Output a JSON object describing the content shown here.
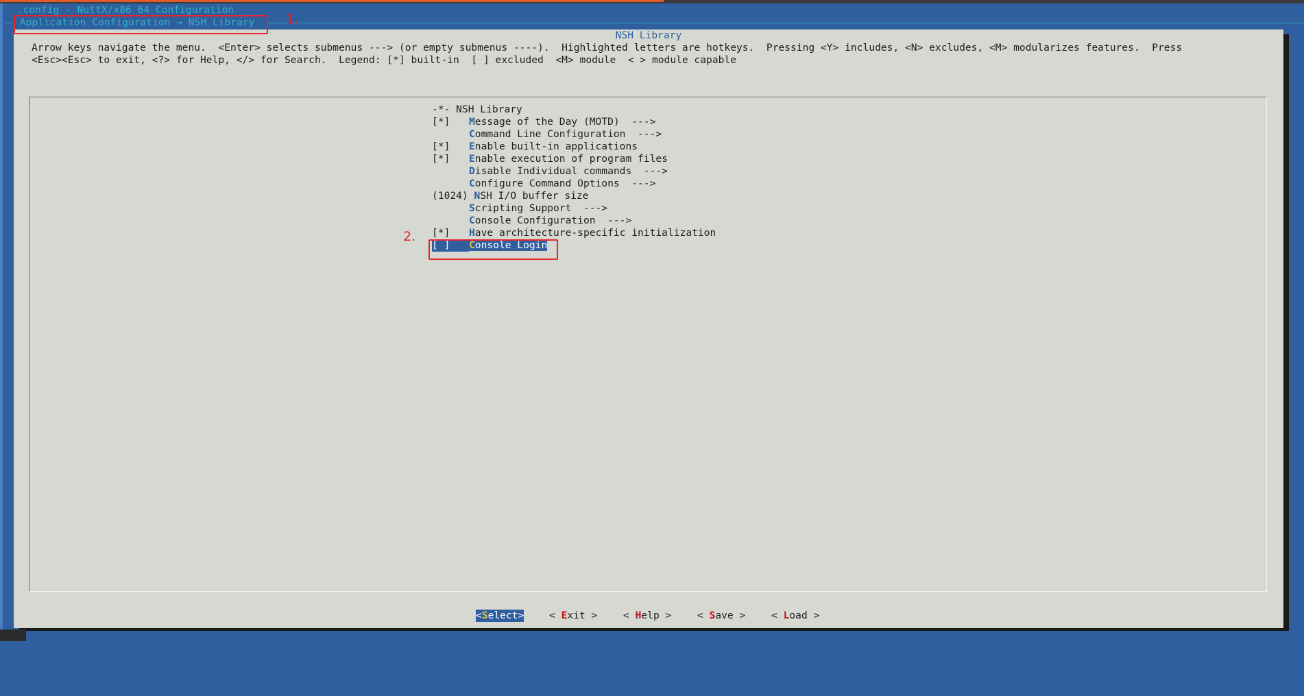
{
  "window": {
    "title": " .config - NuttX/x86_64 Configuration",
    "breadcrumb": " Application Configuration → NSH Library "
  },
  "annotations": [
    {
      "label": "1."
    },
    {
      "label": "2."
    }
  ],
  "dialog": {
    "title": "NSH Library",
    "help_line1": "Arrow keys navigate the menu.  <Enter> selects submenus ---> (or empty submenus ----).  Highlighted letters are hotkeys.  Pressing <Y> includes, <N> excludes, <M> modularizes features.  Press",
    "help_line2": "<Esc><Esc> to exit, <?> for Help, </> for Search.  Legend: [*] built-in  [ ] excluded  <M> module  < > module capable"
  },
  "menu": {
    "items": [
      {
        "prefix": "-*- ",
        "hotkey": "",
        "rest": "NSH Library",
        "prefix_full": true
      },
      {
        "prefix": "[*]",
        "hotkey": "M",
        "rest": "essage of the Day (MOTD)  --->"
      },
      {
        "prefix": "",
        "hotkey": "C",
        "rest": "ommand Line Configuration  --->"
      },
      {
        "prefix": "[*]",
        "hotkey": "E",
        "rest": "nable built-in applications"
      },
      {
        "prefix": "[*]",
        "hotkey": "E",
        "rest": "nable execution of program files"
      },
      {
        "prefix": "",
        "hotkey": "D",
        "rest": "isable Individual commands  --->"
      },
      {
        "prefix": "",
        "hotkey": "C",
        "rest": "onfigure Command Options  --->"
      },
      {
        "prefix": "(1024) ",
        "hotkey": "N",
        "rest": "SH I/O buffer size",
        "prefix_full": true
      },
      {
        "prefix": "",
        "hotkey": "S",
        "rest": "cripting Support  --->"
      },
      {
        "prefix": "",
        "hotkey": "C",
        "rest": "onsole Configuration  --->"
      },
      {
        "prefix": "[*]",
        "hotkey": "H",
        "rest": "ave architecture-specific initialization"
      },
      {
        "prefix": "[ ]",
        "hotkey": "C",
        "rest": "onsole Login",
        "selected": true
      }
    ]
  },
  "buttons": {
    "select": {
      "open": "<",
      "hotkey": "S",
      "rest": "elect",
      "close": ">"
    },
    "exit": {
      "open": "< ",
      "hotkey": "E",
      "rest": "xit",
      "close": " >"
    },
    "help": {
      "open": "< ",
      "hotkey": "H",
      "rest": "elp",
      "close": " >"
    },
    "save": {
      "open": "< ",
      "hotkey": "S",
      "rest": "ave",
      "close": " >"
    },
    "load": {
      "open": "< ",
      "hotkey": "L",
      "rest": "oad",
      "close": " >"
    }
  },
  "colors": {
    "background": "#2f5f9f",
    "dialog": "#d6d9d1",
    "hotkey": "#2f5f9f",
    "button_hotkey": "#c1121f",
    "annotation": "#e8262a"
  }
}
